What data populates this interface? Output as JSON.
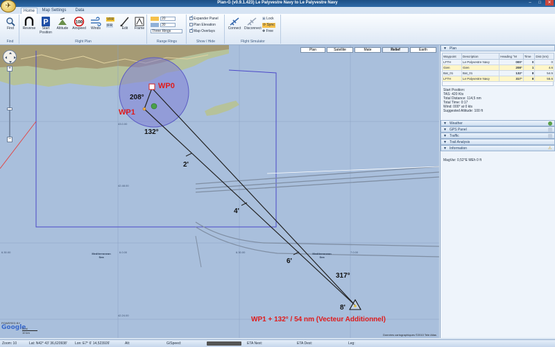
{
  "window": {
    "title": "Plan-G (v0.9.1.423) Le Palyvestre Navy to Le Palyvestre Navy"
  },
  "ribbon_tabs": [
    "Home",
    "Map Settings",
    "Data"
  ],
  "ribbon": {
    "find": {
      "button": "Find",
      "group": "Find"
    },
    "flight_plan": {
      "buttons": [
        "Reverse",
        "Start Position",
        "Altitude",
        "Airspeed",
        "Winds",
        "Edit",
        "Frame"
      ],
      "vfr": "VFR",
      "ifr": "IFR",
      "group": "Flight Plan"
    },
    "range_rings": {
      "values": [
        "20",
        "30"
      ],
      "select": "Three Rings",
      "group": "Range Rings"
    },
    "show_hide": {
      "items": [
        {
          "label": "Expander Panel",
          "checked": true
        },
        {
          "label": "Plan Elevation",
          "checked": false
        },
        {
          "label": "Map Overlays",
          "checked": true
        }
      ],
      "group": "Show / Hide"
    },
    "flight_simulator": {
      "buttons": [
        "Connect",
        "Disconnect"
      ],
      "toggles": [
        "Lock",
        "Sync",
        "Free"
      ],
      "group": "Flight Simulator"
    }
  },
  "map": {
    "types": [
      "Plan",
      "Satellite",
      "Mate",
      "Relief",
      "Earth"
    ],
    "active_type": "Relief",
    "waypoints": {
      "wp0": "WP0",
      "wp1": "WP1"
    },
    "headings": {
      "h208": "208°",
      "h132": "132°",
      "h317": "317°"
    },
    "time_marks": {
      "m2": "2'",
      "m4": "4'",
      "m6": "6'",
      "m8": "8'"
    },
    "leg_note": "WP1 + 132° / 54 nm (Vecteur Additionnel)",
    "sea_labels": [
      "Mediterranean Sea",
      "Mediterranean Sea"
    ],
    "grid_labels": [
      "42.48.00",
      "42.24.00",
      "6.30.00",
      "6.0.00",
      "6.30.00",
      "7.0.00",
      "43.0.00"
    ],
    "powered_by": "POWERED BY",
    "google": "Google",
    "scale": {
      "top": "5 mi",
      "bottom": "10 km"
    },
    "copyright": "Données cartographiques ©2010 Tele Atlas"
  },
  "right_panel": {
    "plan": {
      "header": "Plan",
      "columns": [
        "Waypoint",
        "Description",
        "Heading °M",
        "Time",
        "Dist (nm)"
      ],
      "rows": [
        [
          "LFTH",
          "Le Palyvestre Navy",
          "000°",
          "0",
          "0"
        ],
        [
          "Gien",
          "Gien",
          "208°",
          "1",
          "4.6"
        ],
        [
          "Bat_01",
          "Bat_01",
          "132°",
          "8",
          "54.5"
        ],
        [
          "LFTH",
          "Le Palyvestre Navy",
          "317°",
          "8",
          "55.6"
        ]
      ],
      "info": [
        "Start Position:",
        "TAS: 420 Kts",
        "Total Distance: 114,5 nm",
        "Total Time: 0:17",
        "Wind: 000° at 0 kts",
        "Suggested Altitude: 100 ft"
      ]
    },
    "sections": [
      "Weather",
      "GPS Panel",
      "Traffic",
      "Trail Analysis",
      "Information"
    ],
    "magvar": "MagVar: 0,52°E MEh 0 ft"
  },
  "status": {
    "zoom": "Zoom: 10",
    "lat": "Lat: N42° 43' 36,620938'",
    "lon": "Lon: E7° 6' 14,523926'",
    "alt": "Alt:",
    "gspeed": "G/Speed:",
    "eta_next": "ETA Next:",
    "eta_dest": "ETA Dest:",
    "leg": "Leg:"
  }
}
